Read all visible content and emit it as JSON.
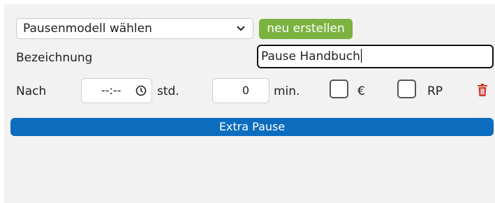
{
  "model_select": {
    "value": "Pausenmodell wählen",
    "icon": "chevron-down-icon"
  },
  "new_button": {
    "label": "neu erstellen",
    "color": "#7bb240"
  },
  "name_field": {
    "label": "Bezeichnung",
    "value": "Pause Handbuch"
  },
  "after": {
    "label": "Nach",
    "time_value": "--:--",
    "time_icon": "clock-icon",
    "hours_unit": "std.",
    "minutes_value": "0",
    "minutes_unit": "min."
  },
  "options": [
    {
      "label": "€",
      "checked": false
    },
    {
      "label": "RP",
      "checked": false
    }
  ],
  "delete_icon": {
    "name": "trash-icon",
    "color": "#cc3b2b"
  },
  "extra_button": {
    "label": "Extra Pause",
    "color": "#0c6cbe"
  },
  "panel_background": "#f2f2f2"
}
